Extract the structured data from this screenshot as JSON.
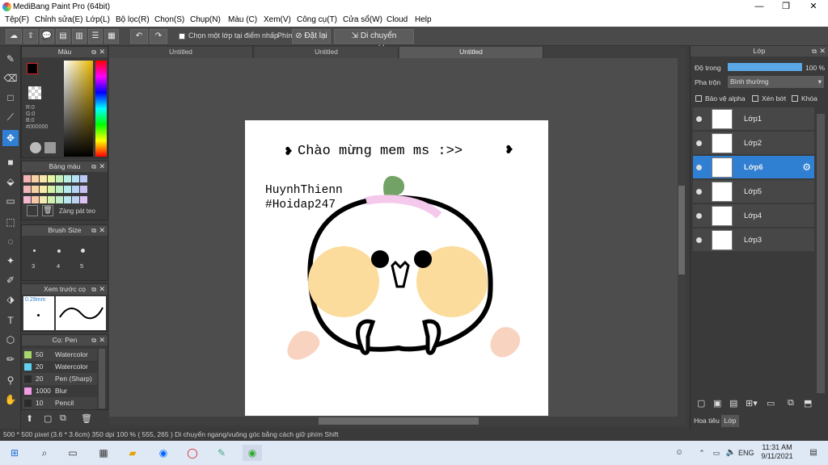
{
  "window": {
    "title": "MediBang Paint Pro (64bit)",
    "minimize": "—",
    "maximize": "❐",
    "close": "✕"
  },
  "menu": [
    "Tệp(F)",
    "Chỉnh sửa(E)",
    "Lớp(L)",
    "Bộ lọc(R)",
    "Chọn(S)",
    "Chụp(N)",
    "Màu (C)",
    "Xem(V)",
    "Công cụ(T)",
    "Cửa sổ(W)",
    "Cloud",
    "Help"
  ],
  "toolbar": {
    "checkbox_label": "Chọn một lớp tại điểm nhấp",
    "phim": "Phím",
    "dat_lai": "Đặt lại",
    "di_chuyen": "Di chuyển ngang/dọc"
  },
  "tabs": [
    "Untitled",
    "Untitled",
    "Untitled"
  ],
  "color_panel": {
    "title": "Màu",
    "r": "R:0",
    "g": "G:0",
    "b": "B:0",
    "hex": "#000000"
  },
  "palette_panel": {
    "title": "Bảng màu",
    "footer": "Zàng pát teo"
  },
  "brush_size_panel": {
    "title": "Brush Size",
    "sizes": [
      "3",
      "4",
      "5"
    ]
  },
  "preview_panel": {
    "title": "Xem trước cọ",
    "size": "0.29mm"
  },
  "brush_panel": {
    "title": "Cọ: Pen",
    "items": [
      {
        "size": "50",
        "name": "Watercolor",
        "color": "#a7d66b"
      },
      {
        "size": "20",
        "name": "Watercolor",
        "color": "#5fd0f0"
      },
      {
        "size": "20",
        "name": "Pen (Sharp)",
        "color": "#2b2b2b"
      },
      {
        "size": "1000",
        "name": "Blur",
        "color": "#f19be4"
      },
      {
        "size": "10",
        "name": "Pencil",
        "color": "#2b2b2b"
      }
    ]
  },
  "canvas": {
    "line1": "Chào mừng mem ms :>>",
    "line2": "HuynhThienn",
    "line3": "#Hoidap247"
  },
  "layer_panel": {
    "title": "Lớp",
    "opacity_label": "Độ trong",
    "opacity_value": "100 %",
    "opacity_fraction": 1.0,
    "blend_label": "Pha trộn",
    "blend_value": "Bình thường",
    "protect_alpha": "Bảo vệ alpha",
    "clipping": "Xén bớt",
    "lock": "Khóa",
    "layers": [
      "Lớp1",
      "Lớp2",
      "Lớp6",
      "Lớp5",
      "Lớp4",
      "Lớp3"
    ],
    "bottom_tabs": [
      "Hoa tiêu",
      "Lớp"
    ]
  },
  "status": {
    "text": "500 * 500 pixel   (3.6 * 3.6cm)   350 dpi   100 %   ( 555, 265 )   Di chuyển ngang/vuông góc bằng cách giữ phím Shift"
  },
  "taskbar": {
    "lang": "ENG",
    "time": "11:31 AM",
    "date": "9/11/2021"
  },
  "colors": {
    "accent": "#2f7fd3",
    "panel": "#3a3a3a",
    "canvas_bg": "#4d4d4d"
  }
}
